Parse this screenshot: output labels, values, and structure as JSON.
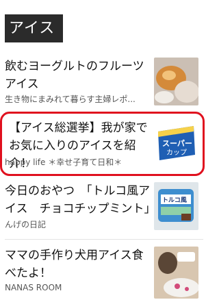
{
  "section": {
    "title": "アイス"
  },
  "items": [
    {
      "title": "飲むヨーグルトのフルーツアイス",
      "source": "生き物にまみれて暮らす主婦レポ..."
    },
    {
      "title": "【アイス総選挙】我が家でお気に入りのアイスを紹介！",
      "source": "happy life ＊幸せ子育て日和＊"
    },
    {
      "title": "今日のおやつ　「トルコ風アイス　チョコチップミント」",
      "source": "んげの日記"
    },
    {
      "title": "ママの手作り犬用アイス食べたよ！",
      "source": "NANAS ROOM"
    }
  ],
  "colors": {
    "highlight": "#e0101e",
    "title_bg": "#2b2b2b"
  }
}
